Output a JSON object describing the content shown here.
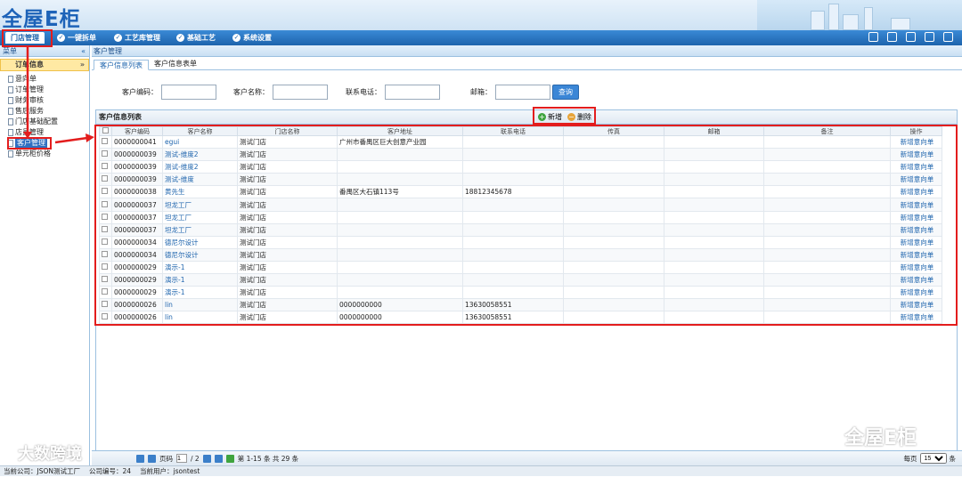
{
  "header": {
    "logo": "全屋E柜"
  },
  "menu": [
    {
      "label": "门店管理"
    },
    {
      "label": "一键拆单"
    },
    {
      "label": "工艺库管理"
    },
    {
      "label": "基础工艺"
    },
    {
      "label": "系统设置"
    }
  ],
  "sidebar": {
    "title": "菜单",
    "collapse": "«",
    "category": "订单信息",
    "category_toggle": "»",
    "items": [
      {
        "label": "意向单"
      },
      {
        "label": "订单管理"
      },
      {
        "label": "财务审核"
      },
      {
        "label": "售后服务"
      },
      {
        "label": "门店基础配置"
      },
      {
        "label": "店员管理"
      },
      {
        "label": "客户管理"
      },
      {
        "label": "单元柜价格"
      }
    ]
  },
  "breadcrumb": "客户管理",
  "tabs": [
    {
      "label": "客户信息列表"
    },
    {
      "label": "客户信息表单"
    }
  ],
  "search": {
    "fields": [
      {
        "label": "客户编码："
      },
      {
        "label": "客户名称："
      },
      {
        "label": "联系电话："
      },
      {
        "label": "邮箱："
      }
    ],
    "query_label": "查询"
  },
  "grid": {
    "title": "客户信息列表",
    "add_label": "新增",
    "delete_label": "删除",
    "columns": [
      "",
      "客户编码",
      "客户名称",
      "门店名称",
      "客户地址",
      "联系电话",
      "传真",
      "邮箱",
      "备注",
      "操作"
    ],
    "rows": [
      [
        "0000000041",
        "egui",
        "测试门店",
        "广州市番禺区巨大创意产业园",
        "",
        "",
        "",
        "",
        "新增意向单"
      ],
      [
        "0000000039",
        "测试-维度2",
        "测试门店",
        "",
        "",
        "",
        "",
        "",
        "新增意向单"
      ],
      [
        "0000000039",
        "测试-维度2",
        "测试门店",
        "",
        "",
        "",
        "",
        "",
        "新增意向单"
      ],
      [
        "0000000039",
        "测试-维度",
        "测试门店",
        "",
        "",
        "",
        "",
        "",
        "新增意向单"
      ],
      [
        "0000000038",
        "黄先生",
        "测试门店",
        "番禺区大石镇113号",
        "18812345678",
        "",
        "",
        "",
        "新增意向单"
      ],
      [
        "0000000037",
        "坦龙工厂",
        "测试门店",
        "",
        "",
        "",
        "",
        "",
        "新增意向单"
      ],
      [
        "0000000037",
        "坦龙工厂",
        "测试门店",
        "",
        "",
        "",
        "",
        "",
        "新增意向单"
      ],
      [
        "0000000037",
        "坦龙工厂",
        "测试门店",
        "",
        "",
        "",
        "",
        "",
        "新增意向单"
      ],
      [
        "0000000034",
        "德尼尔设计",
        "测试门店",
        "",
        "",
        "",
        "",
        "",
        "新增意向单"
      ],
      [
        "0000000034",
        "德尼尔设计",
        "测试门店",
        "",
        "",
        "",
        "",
        "",
        "新增意向单"
      ],
      [
        "0000000029",
        "演示-1",
        "测试门店",
        "",
        "",
        "",
        "",
        "",
        "新增意向单"
      ],
      [
        "0000000029",
        "演示-1",
        "测试门店",
        "",
        "",
        "",
        "",
        "",
        "新增意向单"
      ],
      [
        "0000000029",
        "演示-1",
        "测试门店",
        "",
        "",
        "",
        "",
        "",
        "新增意向单"
      ],
      [
        "0000000026",
        "lin",
        "测试门店",
        "0000000000",
        "13630058551",
        "",
        "",
        "",
        "新增意向单"
      ],
      [
        "0000000026",
        "lin",
        "测试门店",
        "0000000000",
        "13630058551",
        "",
        "",
        "",
        "新增意向单"
      ]
    ]
  },
  "pager": {
    "page_label": "页码",
    "page": "1",
    "total_pages": "/ 2",
    "summary": "第 1-15 条  共 29 条",
    "per_page_label": "每页",
    "per_page": "15",
    "unit": "条"
  },
  "status": {
    "company": "当前公司：JSON测试工厂",
    "company_no": "公司编号：24",
    "user": "当前用户：jsontest"
  },
  "watermark": {
    "left": "大数跨境",
    "right": "全屋E柜"
  }
}
